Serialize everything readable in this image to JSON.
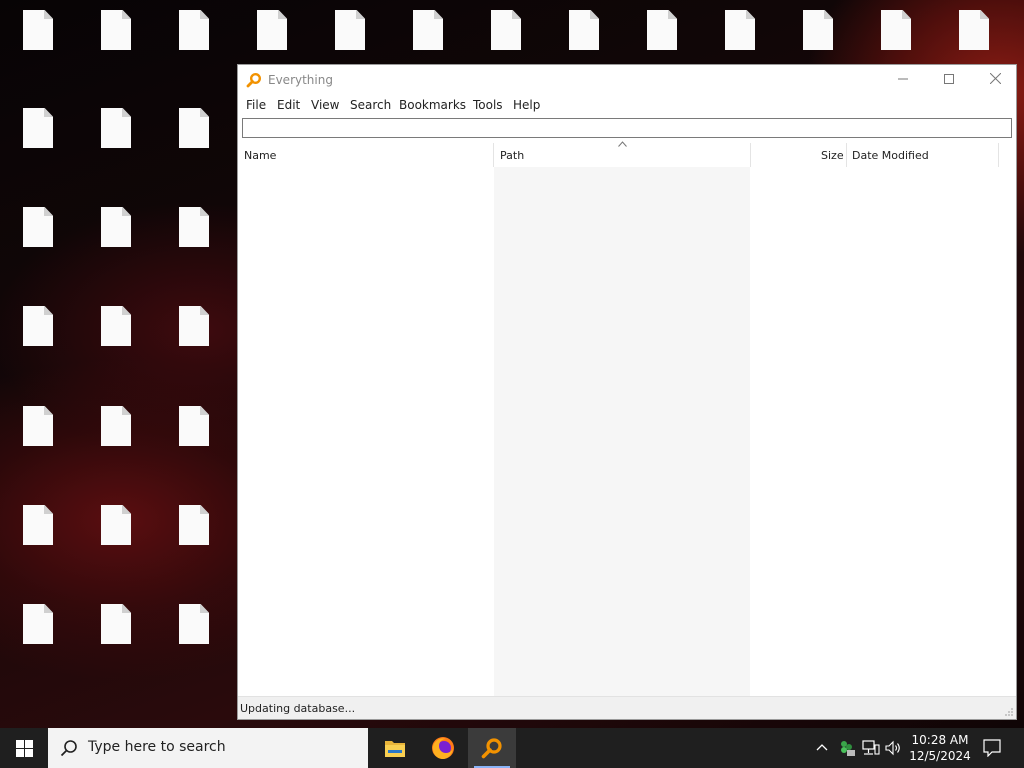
{
  "desktop": {
    "icons": [
      {
        "label": ""
      },
      {
        "label": ""
      },
      {
        "label": ""
      },
      {
        "label": ""
      },
      {
        "label": ""
      },
      {
        "label": ""
      },
      {
        "label": ""
      },
      {
        "label": ""
      },
      {
        "label": ""
      },
      {
        "label": ""
      },
      {
        "label": ""
      },
      {
        "label": ""
      },
      {
        "label": ""
      },
      {
        "label": ""
      },
      {
        "label": ""
      },
      {
        "label": ""
      },
      {
        "label": ""
      },
      {
        "label": ""
      },
      {
        "label": ""
      },
      {
        "label": ""
      },
      {
        "label": ""
      },
      {
        "label": ""
      },
      {
        "label": ""
      },
      {
        "label": ""
      },
      {
        "label": ""
      },
      {
        "label": ""
      },
      {
        "label": ""
      },
      {
        "label": ""
      },
      {
        "label": ""
      },
      {
        "label": ""
      },
      {
        "label": ""
      }
    ]
  },
  "window": {
    "title": "Everything",
    "menu": [
      "File",
      "Edit",
      "View",
      "Search",
      "Bookmarks",
      "Tools",
      "Help"
    ],
    "search_value": "",
    "columns": {
      "name": "Name",
      "path": "Path",
      "size": "Size",
      "date": "Date Modified"
    },
    "sorted_column": "Path",
    "status": "Updating database..."
  },
  "taskbar": {
    "search_placeholder": "Type here to search",
    "apps": [
      "file-explorer-icon",
      "firefox-icon",
      "everything-icon"
    ],
    "active_app": "everything-icon",
    "clock_time": "10:28 AM",
    "clock_date": "12/5/2024"
  },
  "colors": {
    "taskbar_bg": "#1f1f1f",
    "accent": "#8ab4f8",
    "everything_orange": "#f29200"
  }
}
